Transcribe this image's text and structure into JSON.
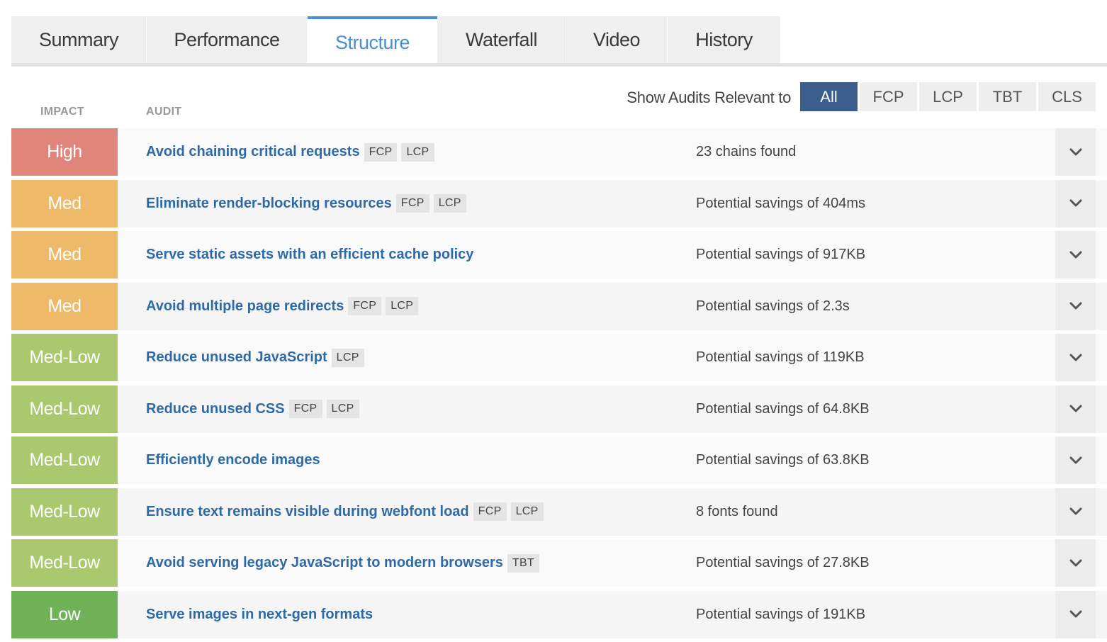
{
  "tabs": [
    {
      "label": "Summary",
      "active": false
    },
    {
      "label": "Performance",
      "active": false
    },
    {
      "label": "Structure",
      "active": true
    },
    {
      "label": "Waterfall",
      "active": false
    },
    {
      "label": "Video",
      "active": false
    },
    {
      "label": "History",
      "active": false
    }
  ],
  "header": {
    "impact_label": "IMPACT",
    "audit_label": "AUDIT",
    "show_audits_label": "Show Audits Relevant to",
    "filters": [
      {
        "label": "All",
        "active": true
      },
      {
        "label": "FCP",
        "active": false
      },
      {
        "label": "LCP",
        "active": false
      },
      {
        "label": "TBT",
        "active": false
      },
      {
        "label": "CLS",
        "active": false
      }
    ]
  },
  "impact_colors": {
    "High": "#e0857a",
    "Med": "#eeba6a",
    "Med-Low": "#aac96f",
    "Low": "#6fb257"
  },
  "audits": [
    {
      "impact": "High",
      "title": "Avoid chaining critical requests",
      "tags": [
        "FCP",
        "LCP"
      ],
      "result": "23 chains found"
    },
    {
      "impact": "Med",
      "title": "Eliminate render-blocking resources",
      "tags": [
        "FCP",
        "LCP"
      ],
      "result": "Potential savings of 404ms"
    },
    {
      "impact": "Med",
      "title": "Serve static assets with an efficient cache policy",
      "tags": [],
      "result": "Potential savings of 917KB"
    },
    {
      "impact": "Med",
      "title": "Avoid multiple page redirects",
      "tags": [
        "FCP",
        "LCP"
      ],
      "result": "Potential savings of 2.3s"
    },
    {
      "impact": "Med-Low",
      "title": "Reduce unused JavaScript",
      "tags": [
        "LCP"
      ],
      "result": "Potential savings of 119KB"
    },
    {
      "impact": "Med-Low",
      "title": "Reduce unused CSS",
      "tags": [
        "FCP",
        "LCP"
      ],
      "result": "Potential savings of 64.8KB"
    },
    {
      "impact": "Med-Low",
      "title": "Efficiently encode images",
      "tags": [],
      "result": "Potential savings of 63.8KB"
    },
    {
      "impact": "Med-Low",
      "title": "Ensure text remains visible during webfont load",
      "tags": [
        "FCP",
        "LCP"
      ],
      "result": "8 fonts found"
    },
    {
      "impact": "Med-Low",
      "title": "Avoid serving legacy JavaScript to modern browsers",
      "tags": [
        "TBT"
      ],
      "result": "Potential savings of 27.8KB"
    },
    {
      "impact": "Low",
      "title": "Serve images in next-gen formats",
      "tags": [],
      "result": "Potential savings of 191KB"
    }
  ]
}
